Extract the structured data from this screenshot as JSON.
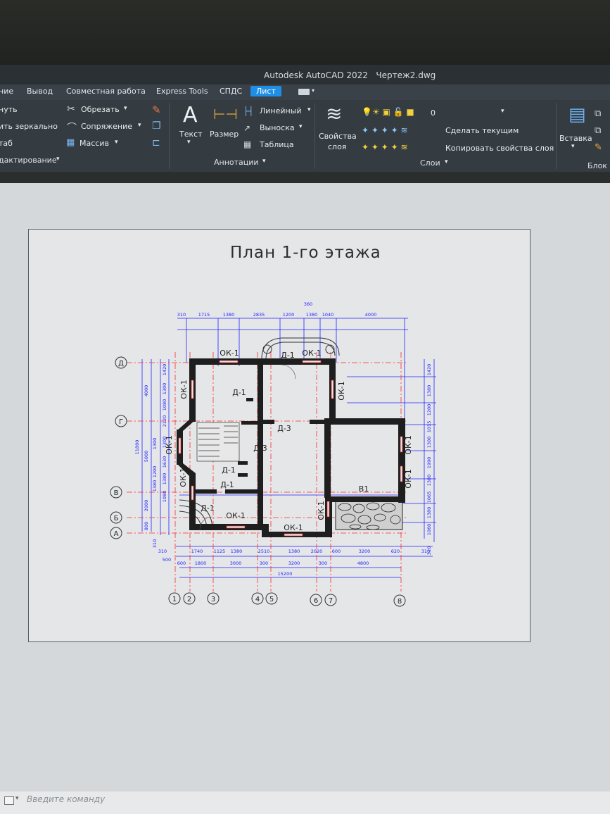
{
  "app": {
    "title": "Autodesk AutoCAD 2022",
    "document": "Чертеж2.dwg"
  },
  "tabs": [
    {
      "label": "ние"
    },
    {
      "label": "Вывод"
    },
    {
      "label": "Совместная работа"
    },
    {
      "label": "Express Tools"
    },
    {
      "label": "СПДС"
    },
    {
      "label": "Лист",
      "active": true
    }
  ],
  "ribbon": {
    "edit": {
      "mirror_partial": "нуть",
      "mirror": "ить зеркально",
      "scale": "таб",
      "panel": "дактирование"
    },
    "modify": {
      "trim": "Обрезать",
      "fillet": "Сопряжение",
      "array": "Массив"
    },
    "annotation": {
      "text": "Текст",
      "dimension": "Размер",
      "linear": "Линейный",
      "leader": "Выноска",
      "table": "Таблица",
      "panel": "Аннотации"
    },
    "layers": {
      "properties_l1": "Свойства",
      "properties_l2": "слоя",
      "current_layer": "0",
      "make_current": "Сделать текущим",
      "match": "Копировать свойства слоя",
      "panel": "Слои"
    },
    "block": {
      "insert": "Вставка",
      "panel": "Блок"
    }
  },
  "drawing": {
    "title": "План 1-го этажа",
    "axes_letters": [
      "Д",
      "Г",
      "В",
      "Б",
      "А"
    ],
    "axes_numbers": [
      "1",
      "2",
      "3",
      "4",
      "5",
      "6",
      "7",
      "8"
    ],
    "top_dims": [
      "310",
      "1715",
      "1380",
      "2835",
      "1200",
      "1380",
      "1040",
      "4000"
    ],
    "top_extra": "360",
    "bottom_dims_1": [
      "310",
      "1740",
      "1125",
      "1380",
      "2510",
      "1380",
      "2020",
      "600",
      "3200",
      "620",
      "310"
    ],
    "bottom_dims_2": [
      "600",
      "1800",
      "3000",
      "300",
      "3200",
      "300",
      "4800"
    ],
    "bottom_dims_3": [
      "500"
    ],
    "total_width": "15200",
    "left_dims": [
      "4000",
      "11800",
      "5000",
      "2000",
      "800"
    ],
    "left_small": [
      "1420",
      "1300",
      "1080",
      "2120",
      "1300",
      "1630",
      "1380",
      "1080",
      "1380",
      "1200",
      "310",
      "1300"
    ],
    "right_dims": [
      "1420",
      "1380",
      "1200",
      "1015",
      "1300",
      "1990",
      "1380",
      "1065",
      "1380",
      "1060",
      "310"
    ],
    "window_tags": [
      "ОК-1",
      "ОК-1",
      "ОК-1",
      "ОК-1",
      "ОК-1",
      "ОК-1",
      "ОК-1",
      "ОК-1",
      "ОК-1",
      "ОК-1"
    ],
    "door_tags": [
      "Д-1",
      "Д-1",
      "Д-3",
      "Д-3",
      "Д-1",
      "Д-1",
      "Д-1"
    ],
    "room_b1": "В1"
  },
  "command": {
    "placeholder": "Введите команду"
  },
  "colors": {
    "accent": "#1f8ee6",
    "dim_blue": "#2323ff",
    "axis_red": "#ff2a2a",
    "wall": "#1e1e1e"
  }
}
